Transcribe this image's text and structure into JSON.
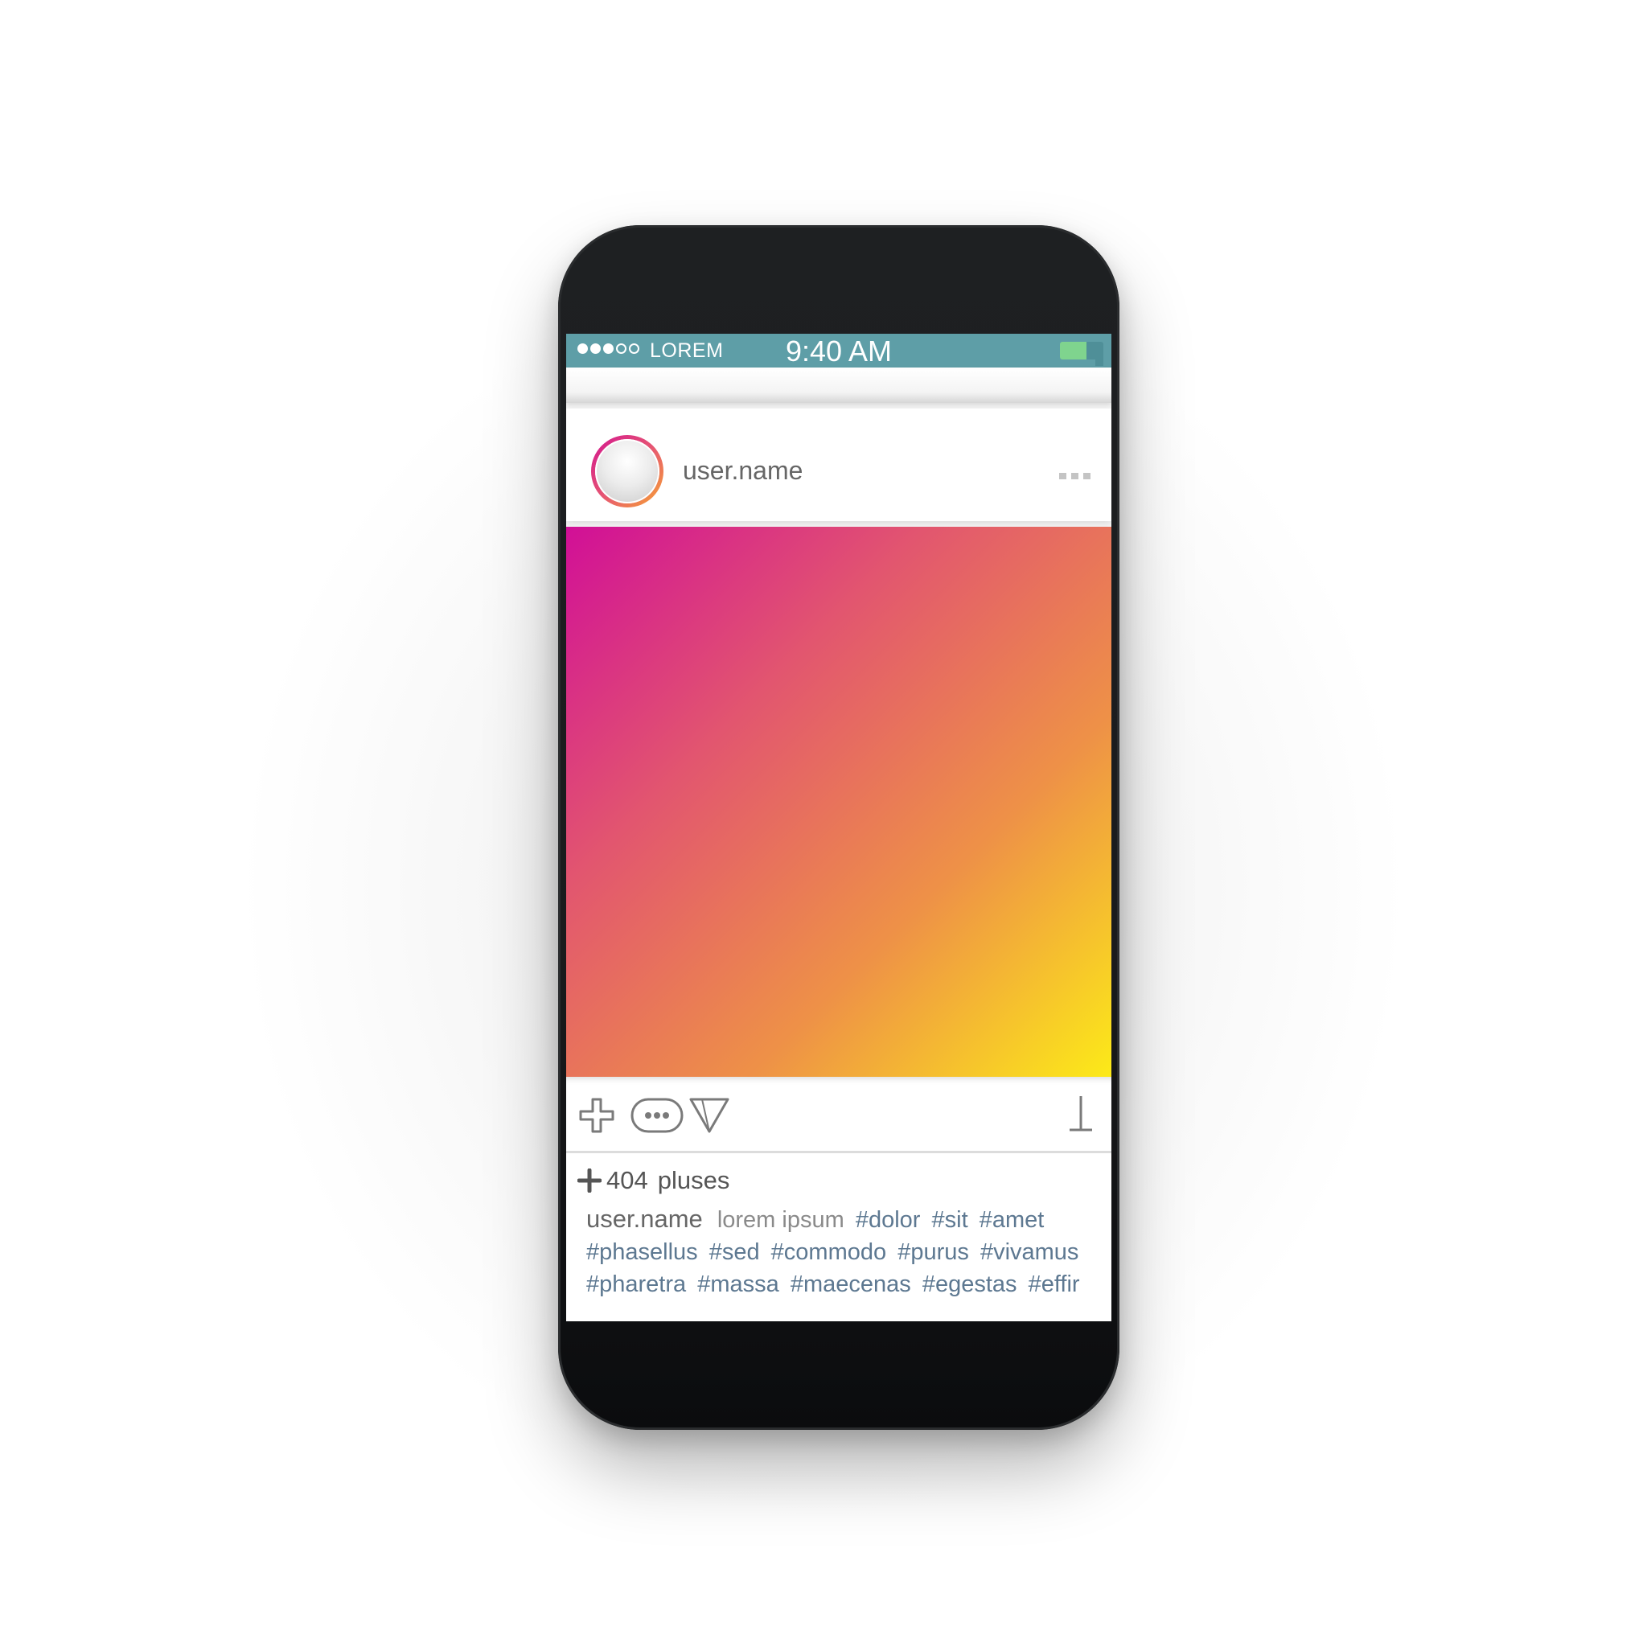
{
  "status_bar": {
    "signal_dots": 5,
    "signal_filled": 3,
    "carrier": "LOREM",
    "time": "9:40 AM",
    "battery_level": 0.62,
    "color": "#5e9ea7"
  },
  "post": {
    "username": "user.name",
    "more_icon": "more-horizontal-icon",
    "image_gradient": [
      "#d10f97",
      "#e2566f",
      "#ee9147",
      "#fcea18"
    ]
  },
  "actions": {
    "icons": [
      "plus-icon",
      "comment-bubble-icon",
      "send-icon",
      "bookmark-icon"
    ]
  },
  "stats": {
    "count": "404",
    "label": "pluses"
  },
  "caption": {
    "username": "user.name",
    "text": "lorem ipsum",
    "hashtags": [
      "#dolor",
      "#sit",
      "#amet",
      "#phasellus",
      "#sed",
      "#commodo",
      "#purus",
      "#vivamus",
      "#pharetra",
      "#massa",
      "#maecenas",
      "#egestas",
      "#effir"
    ]
  }
}
